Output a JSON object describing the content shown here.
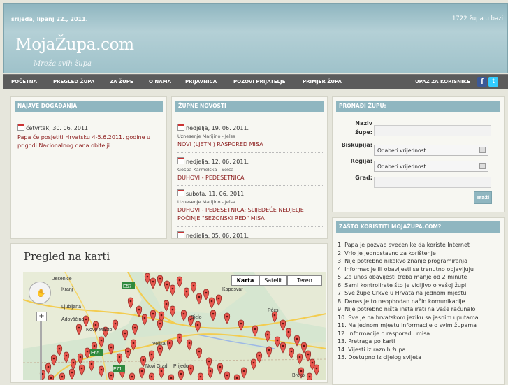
{
  "header": {
    "date": "srijeda, lipanj 22., 2011.",
    "count": "1722 župa u bazi",
    "logo": "MojaŽupa.com",
    "tagline": "Mreža svih župa"
  },
  "nav": {
    "items": [
      "POČETNA",
      "PREGLED ŽUPA",
      "ZA ŽUPE",
      "O NAMA",
      "PRIJAVNICA",
      "POZOVI PRIJATELJE",
      "PRIMJER ŽUPA",
      "UPAZ ZA KORISNIKE"
    ],
    "login": "UPAZ ZA KORISNIKE",
    "facebook_letter": "f",
    "twitter_letter": "t"
  },
  "events": {
    "title": "NAJAVE DOGAĐANJA",
    "date": "četvrtak, 30. 06. 2011.",
    "text": "Papa će posjetiti Hrvatsku 4-5.6.2011. godine u prigodi Nacionalnog dana obitelji."
  },
  "news": {
    "title": "ŽUPNE NOVOSTI",
    "items": [
      {
        "date": "nedjelja, 19. 06. 2011.",
        "parish": "Uznesenje Marijino - Jelsa",
        "headline": "NOVI (LJETNI) RASPORED MISA"
      },
      {
        "date": "nedjelja, 12. 06. 2011.",
        "parish": "Gospa Karmelska - Selca",
        "headline": "DUHOVI - PEDESETNICA"
      },
      {
        "date": "subota, 11. 06. 2011.",
        "parish": "Uznesenje Marijino - Jelsa",
        "headline": "DUHOVI - PEDESETNICA: SLIJEDEĆE NEDJELJE POČINJE \"SEZONSKI RED\" MISA"
      },
      {
        "date": "nedjelja, 05. 06. 2011.",
        "parish": "",
        "headline": ""
      }
    ]
  },
  "search": {
    "title": "PRONAĐI ŽUPU:",
    "name_label_1": "Naziv",
    "name_label_2": "župe:",
    "diocese_label": "Biskupija:",
    "diocese_value": "Odaberi vrijednost",
    "region_label": "Regija:",
    "region_value": "Odaberi vrijednost",
    "city_label": "Grad:",
    "button": "Traži"
  },
  "reasons": {
    "title": "ZAŠTO KORISTITI MOJAŽUPA.COM?",
    "items": [
      "1. Papa je pozvao svećenike da koriste Internet",
      "2. Vrlo je jednostavno za korištenje",
      "3. Nije potrebno nikakvo znanje programiranja",
      "4. Informacije ili obavijesti se trenutno objavljuju",
      "5. Za unos obavijesti treba manje od 2 minute",
      "6. Sami kontrolirate što je vidljivo o vašoj župi",
      "7. Sve župe Crkve u Hrvata na jednom mjestu",
      "8. Danas je to neophodan način komunikacije",
      "9. Nije potrebno ništa instalirati na vaše računalo",
      "10. Sve je na hrvatskom jeziku sa jasnim uputama",
      "11. Na jednom mjestu informacije o svim župama",
      "12. Informacije o rasporedu misa",
      "13. Pretraga po karti",
      "14. Vijesti iz raznih župa",
      "15. Dostupno iz cijelog svijeta"
    ]
  },
  "map": {
    "title": "Pregled na karti",
    "tabs": [
      "Karta",
      "Satelit",
      "Teren"
    ],
    "places": [
      "Jesenice",
      "Kranj",
      "Ljubljana",
      "Adovščina",
      "Novo Mesto",
      "Kaposvár",
      "Pécs",
      "Bjelo",
      "Velika",
      "Brčko",
      "Novi Grad",
      "Prijedor",
      "E57",
      "E65",
      "E71"
    ]
  }
}
